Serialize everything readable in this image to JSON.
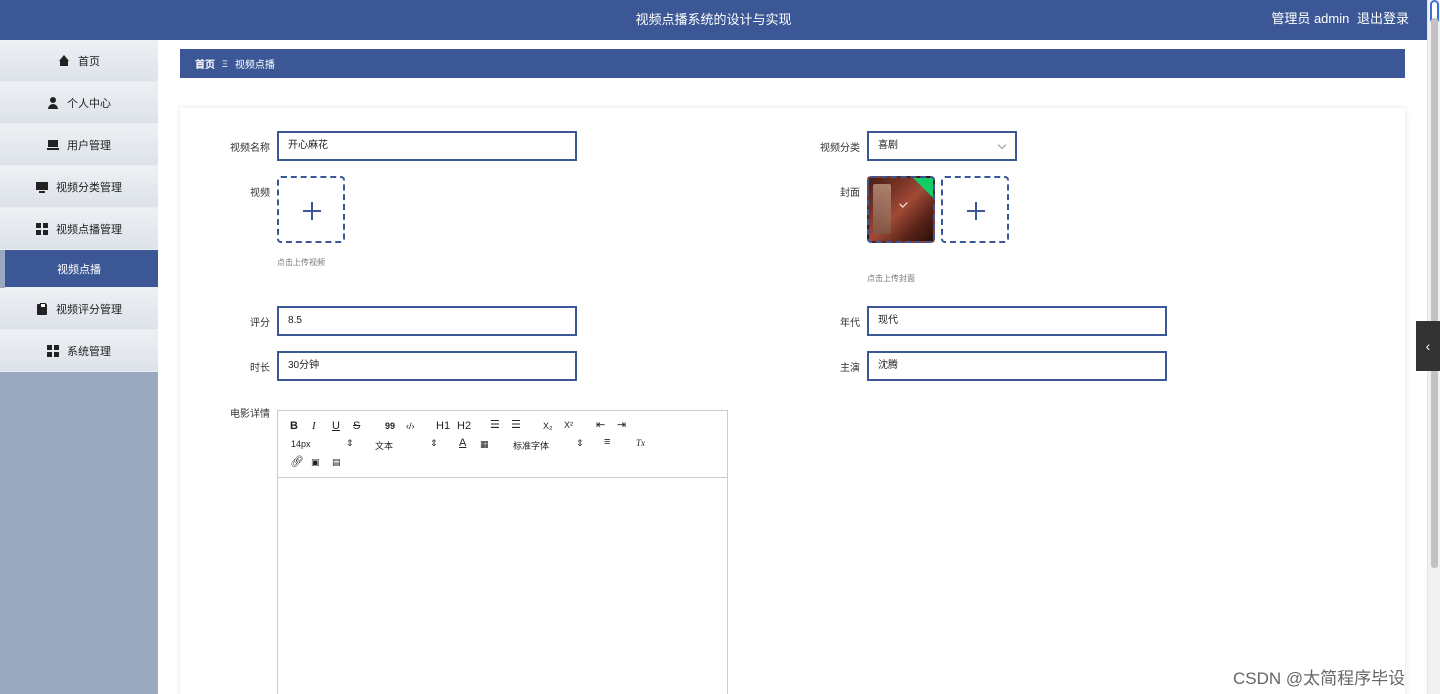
{
  "header": {
    "title": "视频点播系统的设计与实现",
    "user": "管理员 admin",
    "logout": "退出登录"
  },
  "sidebar": {
    "items": [
      {
        "label": "首页",
        "icon": "home-icon"
      },
      {
        "label": "个人中心",
        "icon": "user-icon"
      },
      {
        "label": "用户管理",
        "icon": "desk-icon"
      },
      {
        "label": "视频分类管理",
        "icon": "monitor-icon"
      },
      {
        "label": "视频点播管理",
        "icon": "grid-icon"
      },
      {
        "label": "视频点播",
        "icon": ""
      },
      {
        "label": "视频评分管理",
        "icon": "clipboard-icon"
      },
      {
        "label": "系统管理",
        "icon": "grid-icon"
      }
    ]
  },
  "breadcrumb": {
    "home": "首页",
    "separator": "Ξ",
    "current": "视频点播"
  },
  "form": {
    "name_label": "视频名称",
    "name_value": "开心麻花",
    "category_label": "视频分类",
    "category_value": "喜剧",
    "video_label": "视频",
    "video_hint": "点击上传视频",
    "cover_label": "封面",
    "cover_hint": "点击上传封面",
    "rating_label": "评分",
    "rating_value": "8.5",
    "year_label": "年代",
    "year_value": "现代",
    "duration_label": "时长",
    "duration_value": "30分钟",
    "actor_label": "主演",
    "actor_value": "沈腾",
    "detail_label": "电影详情"
  },
  "editor": {
    "bold": "B",
    "italic": "I",
    "underline": "U",
    "strike": "S",
    "quote": "99",
    "code": "‹/›",
    "h1": "H1",
    "h2": "H2",
    "sub": "X₂",
    "sup": "X²",
    "font_size": "14px",
    "header_select": "文本",
    "font_family": "标准字体",
    "font_color": "A",
    "clean": "Tx"
  },
  "watermark": "CSDN @太简程序毕设",
  "colors": {
    "primary": "#3b5795",
    "sidebar_bg": "#9aa8c0",
    "success": "#13ce66"
  }
}
